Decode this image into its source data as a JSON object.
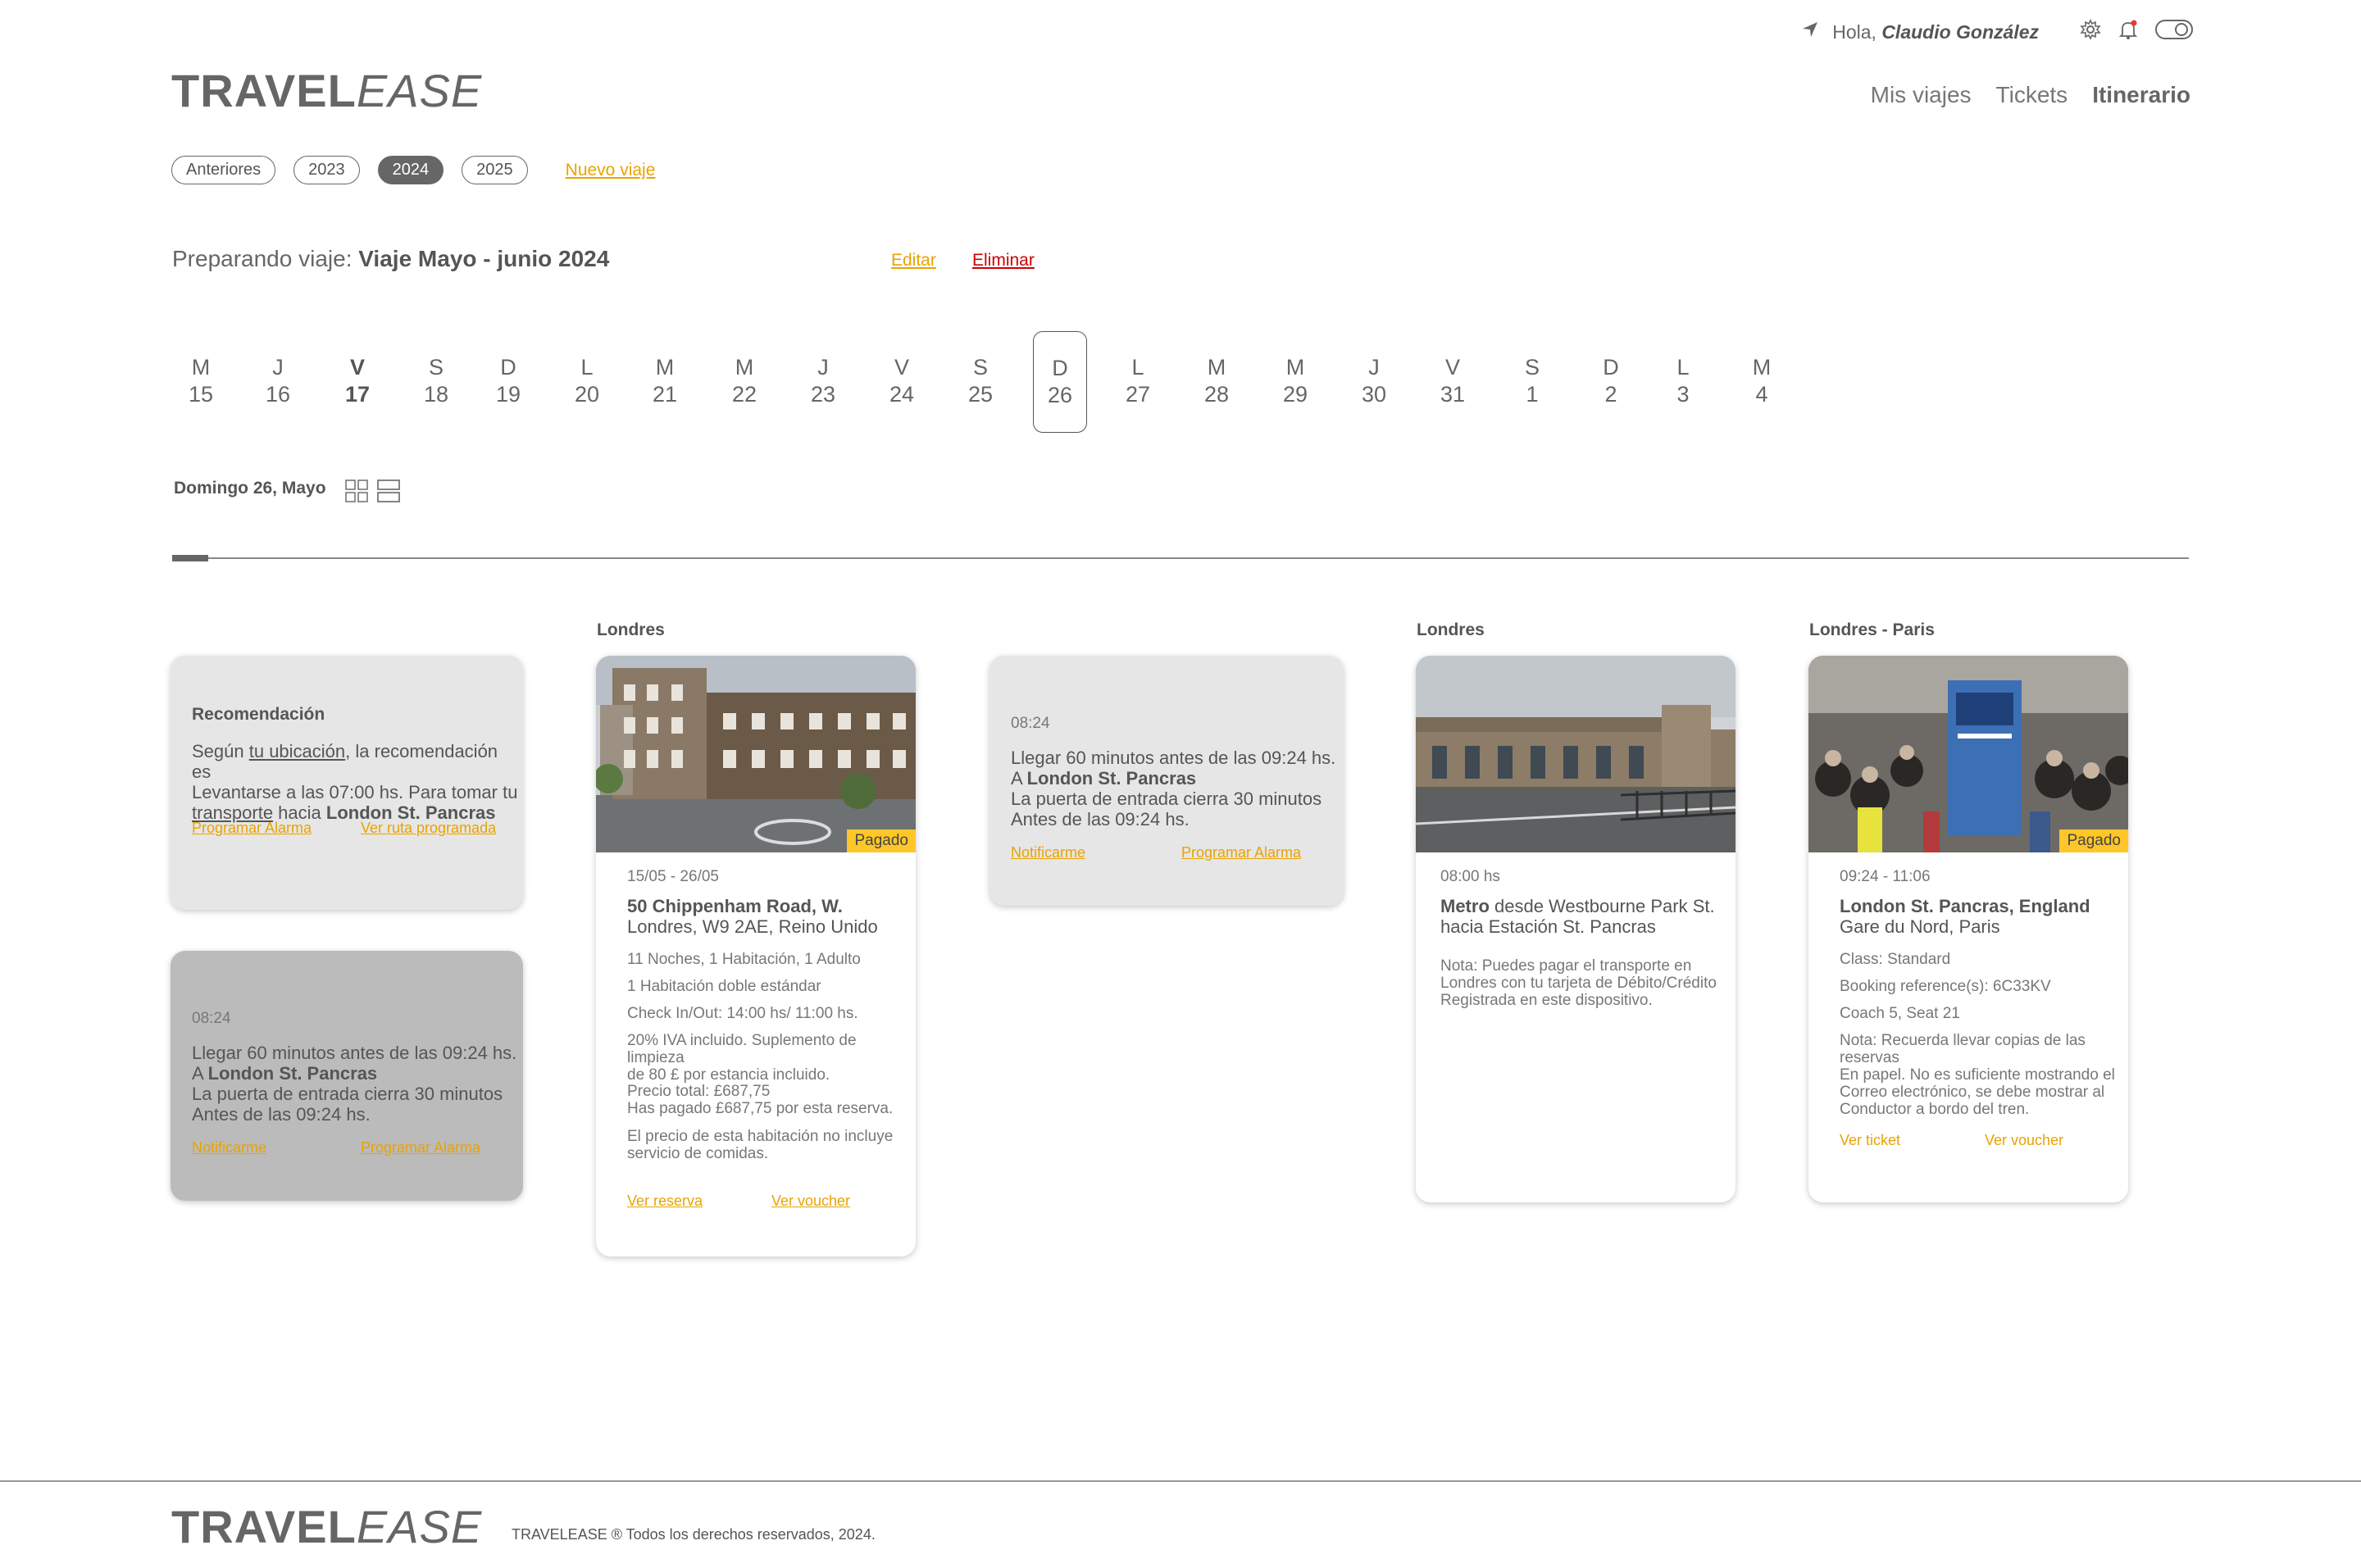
{
  "header": {
    "location_icon": "location-arrow-icon",
    "greeting": "Hola,",
    "user_name": "Claudio González",
    "icons": [
      "gear-icon",
      "bell-icon",
      "toggle-icon"
    ],
    "logo_bold": "TRAVEL",
    "logo_italic": "EASE",
    "nav": [
      "Mis viajes",
      "Tickets",
      "Itinerario"
    ],
    "nav_active": "Itinerario"
  },
  "years": {
    "pills": [
      "Anteriores",
      "2023",
      "2024",
      "2025"
    ],
    "selected": "2024",
    "new_trip": "Nuevo viaje"
  },
  "trip": {
    "prefix": "Preparando viaje:",
    "name": "Viaje Mayo - junio 2024",
    "edit": "Editar",
    "delete": "Eliminar"
  },
  "days": [
    {
      "d": "M",
      "n": "15"
    },
    {
      "d": "J",
      "n": "16"
    },
    {
      "d": "V",
      "n": "17"
    },
    {
      "d": "S",
      "n": "18"
    },
    {
      "d": "D",
      "n": "19"
    },
    {
      "d": "L",
      "n": "20"
    },
    {
      "d": "M",
      "n": "21"
    },
    {
      "d": "M",
      "n": "22"
    },
    {
      "d": "J",
      "n": "23"
    },
    {
      "d": "V",
      "n": "24"
    },
    {
      "d": "S",
      "n": "25"
    },
    {
      "d": "D",
      "n": "26"
    },
    {
      "d": "L",
      "n": "27"
    },
    {
      "d": "M",
      "n": "28"
    },
    {
      "d": "M",
      "n": "29"
    },
    {
      "d": "J",
      "n": "30"
    },
    {
      "d": "V",
      "n": "31"
    },
    {
      "d": "S",
      "n": "1"
    },
    {
      "d": "D",
      "n": "2"
    },
    {
      "d": "L",
      "n": "3"
    },
    {
      "d": "M",
      "n": "4"
    }
  ],
  "today_day": "17",
  "selected_day": "26",
  "day_heading": "Domingo 26, Mayo",
  "view_icons": [
    "grid-view-icon",
    "list-view-icon"
  ],
  "columns": {
    "col2": "Londres",
    "col4": "Londres",
    "col5": "Londres - Paris"
  },
  "recommendation": {
    "title": "Recomendación",
    "line1_pre": "Según ",
    "line1_link": "tu ubicación",
    "line1_post": ", la recomendación es",
    "line2": "Levantarse a las 07:00 hs. Para tomar tu",
    "line3_link": "transporte",
    "line3_mid": " hacia ",
    "line3_bold": "London St. Pancras",
    "action1": "Programar Alarma",
    "action2": "Ver ruta programada"
  },
  "alarm_dark": {
    "time": "08:24",
    "line1": "Llegar 60 minutos antes de las 09:24 hs.",
    "line2_pre": "A ",
    "line2_bold": "London St. Pancras",
    "line3": "La puerta de entrada cierra 30 minutos",
    "line4": "Antes de las 09:24 hs.",
    "action1": "Notificarme",
    "action2": "Programar Alarma"
  },
  "alarm_light": {
    "time": "08:24",
    "line1": "Llegar 60 minutos antes de las 09:24 hs.",
    "line2_pre": "A ",
    "line2_bold": "London St. Pancras",
    "line3": "La puerta de entrada cierra 30 minutos",
    "line4": "Antes de las 09:24 hs.",
    "action1": "Notificarme",
    "action2": "Programar Alarma"
  },
  "hotel": {
    "badge": "Pagado",
    "dates": "15/05 - 26/05",
    "address_bold": "50 Chippenham Road, W.",
    "address2": "Londres, W9 2AE, Reino Unido",
    "d1": "11 Noches, 1 Habitación, 1 Adulto",
    "d2": "1 Habitación doble estándar",
    "d3": "Check In/Out: 14:00 hs/ 11:00 hs.",
    "d4a": "20% IVA incluido. Suplemento de limpieza",
    "d4b": "de 80 £ por estancia incluido.",
    "d5a": "Precio total: £687,75",
    "d5b": "Has pagado £687,75 por esta reserva.",
    "d6a": "El precio de esta habitación no incluye",
    "d6b": "servicio de comidas.",
    "action1": "Ver reserva",
    "action2": "Ver voucher"
  },
  "metro": {
    "time": "08:00 hs",
    "line1_bold": "Metro",
    "line1_rest": " desde Westbourne Park St.",
    "line2": "hacia Estación St. Pancras",
    "n1": "Nota: Puedes pagar el transporte en",
    "n2": "Londres con tu tarjeta de Débito/Crédito",
    "n3": "Registrada en este dispositivo."
  },
  "train": {
    "badge": "Pagado",
    "time": "09:24 - 11:06",
    "line1_bold": "London St. Pancras, England",
    "line2": "Gare du Nord, Paris",
    "d1": "Class: Standard",
    "d2": "Booking reference(s): 6C33KV",
    "d3": "Coach 5, Seat 21",
    "n1": "Nota: Recuerda llevar copias de las reservas",
    "n2": "En papel. No es suficiente mostrando el",
    "n3": "Correo electrónico, se debe mostrar al",
    "n4": "Conductor a bordo del tren.",
    "action1": "Ver ticket",
    "action2": "Ver voucher"
  },
  "footer": {
    "logo_bold": "TRAVEL",
    "logo_italic": "EASE",
    "copyright": "TRAVELEASE ® Todos los derechos reservados, 2024."
  },
  "colors": {
    "accent": "#e8a300",
    "danger": "#cc0000",
    "badge": "#ffc629",
    "text": "#555555"
  }
}
